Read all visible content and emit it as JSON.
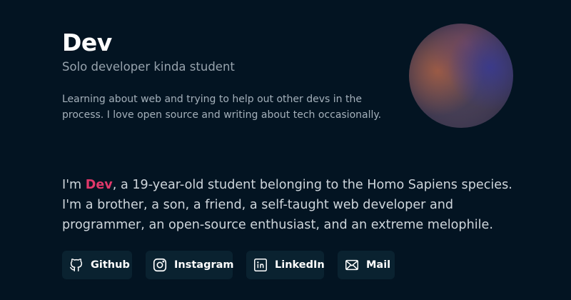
{
  "profile": {
    "name": "Dev",
    "tagline": "Solo developer kinda student",
    "bio": "Learning about web and trying to help out other devs in the process. I love open source and writing about tech occasionally."
  },
  "intro": {
    "prefix": "I'm ",
    "highlight": "Dev",
    "suffix": ", a 19-year-old student belonging to the Homo Sapiens species. I'm a brother, a son, a friend, a self-taught web developer and programmer, an open-source enthusiast, and an extreme melophile."
  },
  "links": [
    {
      "label": "Github",
      "icon": "github-icon"
    },
    {
      "label": "Instagram",
      "icon": "instagram-icon"
    },
    {
      "label": "LinkedIn",
      "icon": "linkedin-icon"
    },
    {
      "label": "Mail",
      "icon": "mail-icon"
    }
  ],
  "colors": {
    "background": "#031422",
    "accent": "#e0386a",
    "button_bg": "#0a2230",
    "heading": "#ffffff",
    "muted": "#97a3ad"
  }
}
